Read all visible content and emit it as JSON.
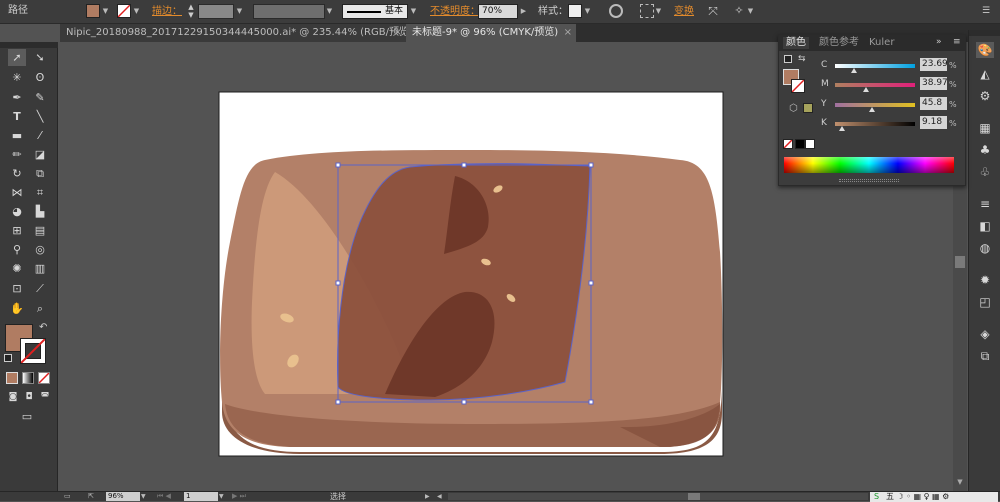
{
  "control_bar": {
    "object_type": "路径",
    "stroke_label": "描边：",
    "stroke_style": "基本",
    "opacity_label": "不透明度：",
    "opacity_value": "70%",
    "style_label": "样式：",
    "transform_label": "变换",
    "fill_color": "#b07c62"
  },
  "tabs": [
    {
      "label": "Nipic_20180988_20171229150344445000.ai* @ 235.44% (RGB/预览)",
      "close": "×",
      "active": false
    },
    {
      "label": "未标题-9* @ 96% (CMYK/预览)",
      "close": "×",
      "active": true
    }
  ],
  "color_panel": {
    "tabs": [
      "颜色",
      "颜色参考",
      "Kuler"
    ],
    "channels": [
      {
        "name": "C",
        "value": "23.69",
        "unit": "%",
        "level": 0.237,
        "gradient": "linear-gradient(to right,#fff,#00a0e0)"
      },
      {
        "name": "M",
        "value": "38.97",
        "unit": "%",
        "level": 0.39,
        "gradient": "linear-gradient(to right,#b08060,#e0207a)"
      },
      {
        "name": "Y",
        "value": "45.8",
        "unit": "%",
        "level": 0.458,
        "gradient": "linear-gradient(to right,#a070a0,#e0c020)"
      },
      {
        "name": "K",
        "value": "9.18",
        "unit": "%",
        "level": 0.092,
        "gradient": "linear-gradient(to right,#c0906e,#000)"
      }
    ],
    "fill_color": "#b07c62"
  },
  "status": {
    "zoom": "96%",
    "page": "1",
    "tool_name": "选择"
  },
  "artwork": {
    "board_color": "#b38068",
    "shadow_color": "#8a5a45",
    "highlight_color": "#d4a27f",
    "chocolate_color": "#8b4f3c",
    "dark_color": "#6b3527",
    "seed_color": "#e8c08e",
    "selection_color": "#5b63c8"
  }
}
